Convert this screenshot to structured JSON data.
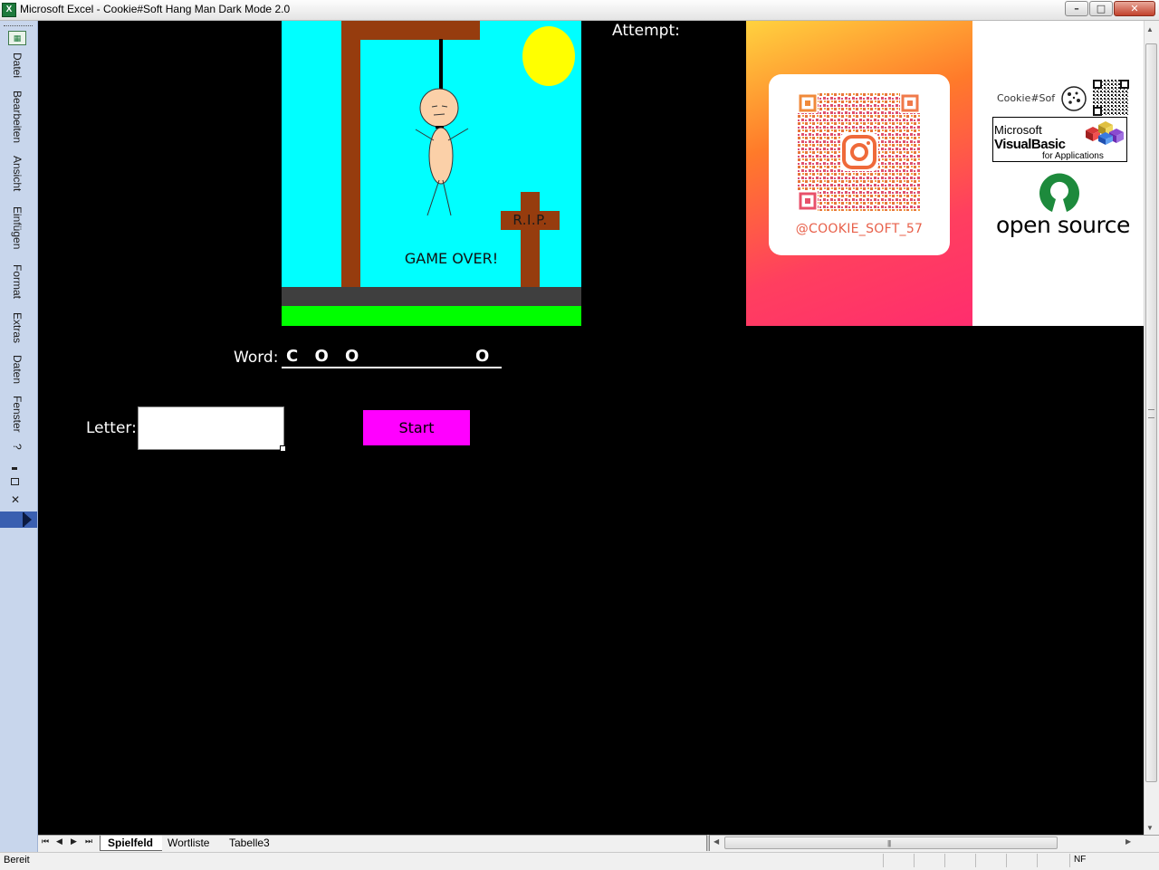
{
  "window": {
    "title": "Microsoft Excel - Cookie#Soft Hang Man Dark Mode 2.0",
    "app_icon": "X",
    "controls": {
      "minimize": "–",
      "maximize": "□",
      "close": "✕"
    }
  },
  "menu": {
    "items": [
      "Datei",
      "Bearbeiten",
      "Ansicht",
      "Einfügen",
      "Format",
      "Extras",
      "Daten",
      "Fenster",
      "?"
    ]
  },
  "game": {
    "rip_text": "R.I.P.",
    "game_over_text": "GAME OVER!",
    "attempt_label": "Attempt:",
    "word_label": "Word:",
    "word_display": "C O O          O",
    "letter_label": "Letter:",
    "letter_value": "",
    "start_label": "Start",
    "colors": {
      "sky": "#00ffff",
      "grass": "#00ff00",
      "wood": "#963c0e",
      "sun": "#ffff00",
      "start_button": "#ff00ff"
    }
  },
  "ads": {
    "instagram_handle": "@COOKIE_SOFT_57",
    "cookie_brand": "Cookie#Sof",
    "vba_line1": "Microsoft",
    "vba_line2": "VisualBasic",
    "vba_line3": "for Applications",
    "open_source": "open source"
  },
  "sheets": {
    "nav": [
      "⏮",
      "◀",
      "▶",
      "⏭"
    ],
    "tabs": [
      "Spielfeld",
      "Wortliste",
      "Tabelle3"
    ],
    "active": "Spielfeld"
  },
  "status": {
    "text": "Bereit",
    "mode": "NF"
  }
}
